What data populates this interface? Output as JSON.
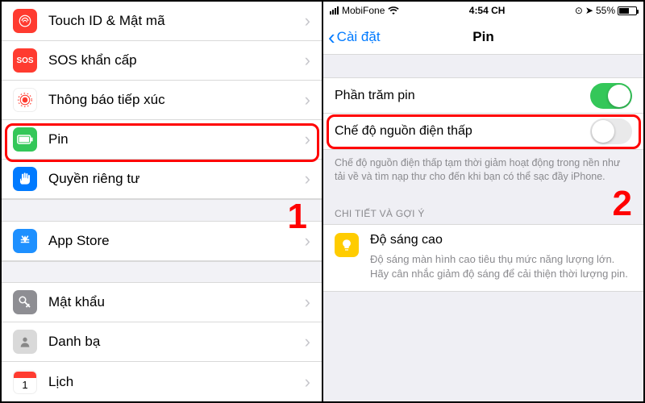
{
  "left": {
    "items": [
      {
        "label": "Touch ID & Mật mã",
        "iconColor": "#ff3b30",
        "icon": "touchid"
      },
      {
        "label": "SOS khẩn cấp",
        "iconColor": "#ff3b30",
        "icon": "sos"
      },
      {
        "label": "Thông báo tiếp xúc",
        "iconColor": "#ffffff",
        "icon": "exposure"
      },
      {
        "label": "Pin",
        "iconColor": "#34c759",
        "icon": "battery",
        "highlighted": true
      },
      {
        "label": "Quyền riêng tư",
        "iconColor": "#007aff",
        "icon": "hand"
      }
    ],
    "items2": [
      {
        "label": "App Store",
        "iconColor": "#1e90ff",
        "icon": "appstore"
      }
    ],
    "items3": [
      {
        "label": "Mật khẩu",
        "iconColor": "#8e8e93",
        "icon": "key"
      },
      {
        "label": "Danh bạ",
        "iconColor": "#d9d9d9",
        "icon": "contacts"
      },
      {
        "label": "Lịch",
        "iconColor": "#ffffff",
        "icon": "calendar"
      }
    ],
    "step": "1"
  },
  "right": {
    "status": {
      "carrier": "MobiFone",
      "time": "4:54 CH",
      "battery": "55%"
    },
    "nav": {
      "back": "Cài đặt",
      "title": "Pin"
    },
    "rows": [
      {
        "label": "Phần trăm pin",
        "on": true
      },
      {
        "label": "Chế độ nguồn điện thấp",
        "on": false,
        "highlighted": true
      }
    ],
    "lowPowerFooter": "Chế độ nguồn điện thấp tạm thời giảm hoạt động trong nền như tải về và tìm nạp thư cho đến khi bạn có thể sạc đầy iPhone.",
    "sectionHeader": "CHI TIẾT VÀ GỢI Ý",
    "insight": {
      "title": "Độ sáng cao",
      "desc": "Độ sáng màn hình cao tiêu thụ mức năng lượng lớn. Hãy cân nhắc giảm độ sáng để cải thiện thời lượng pin."
    },
    "step": "2"
  }
}
